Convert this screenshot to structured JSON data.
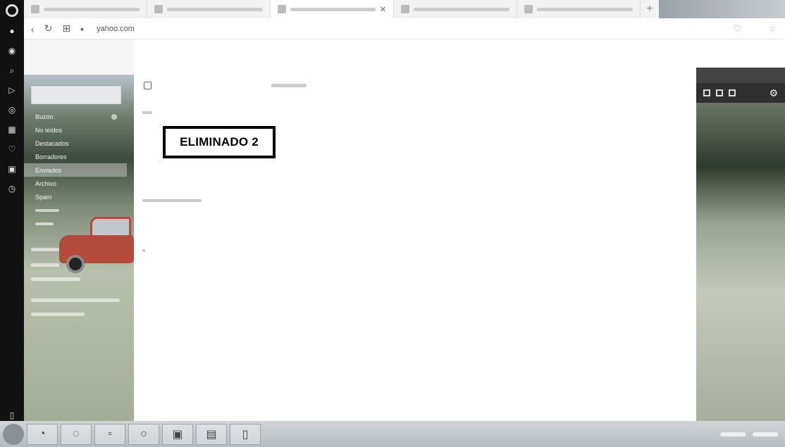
{
  "browser": {
    "url": "yahoo.com",
    "tabs": [
      {
        "active": false
      },
      {
        "active": false
      },
      {
        "active": true
      },
      {
        "active": false
      },
      {
        "active": false
      }
    ],
    "rail_icons": [
      "logo",
      "messenger-icon",
      "whatsapp-icon",
      "search-icon",
      "send-icon",
      "camera-icon",
      "grid-icon",
      "heart-icon",
      "wallet-icon",
      "clock-icon",
      "sidebar-icon"
    ]
  },
  "mail": {
    "folders": [
      {
        "label": "Buzón",
        "active": false
      },
      {
        "label": "No leídos",
        "active": false
      },
      {
        "label": "Destacados",
        "active": false
      },
      {
        "label": "Borradores",
        "active": false
      },
      {
        "label": "Enviados",
        "active": true
      },
      {
        "label": "Archivo",
        "active": false
      },
      {
        "label": "Spam",
        "active": false
      },
      {
        "label": "",
        "active": false
      },
      {
        "label": "",
        "active": false
      }
    ],
    "redaction_label": "ELIMINADO 2"
  },
  "colors": {
    "rail": "#111111",
    "car": "#b34a3a",
    "taskbar": "#b7bcc1"
  }
}
